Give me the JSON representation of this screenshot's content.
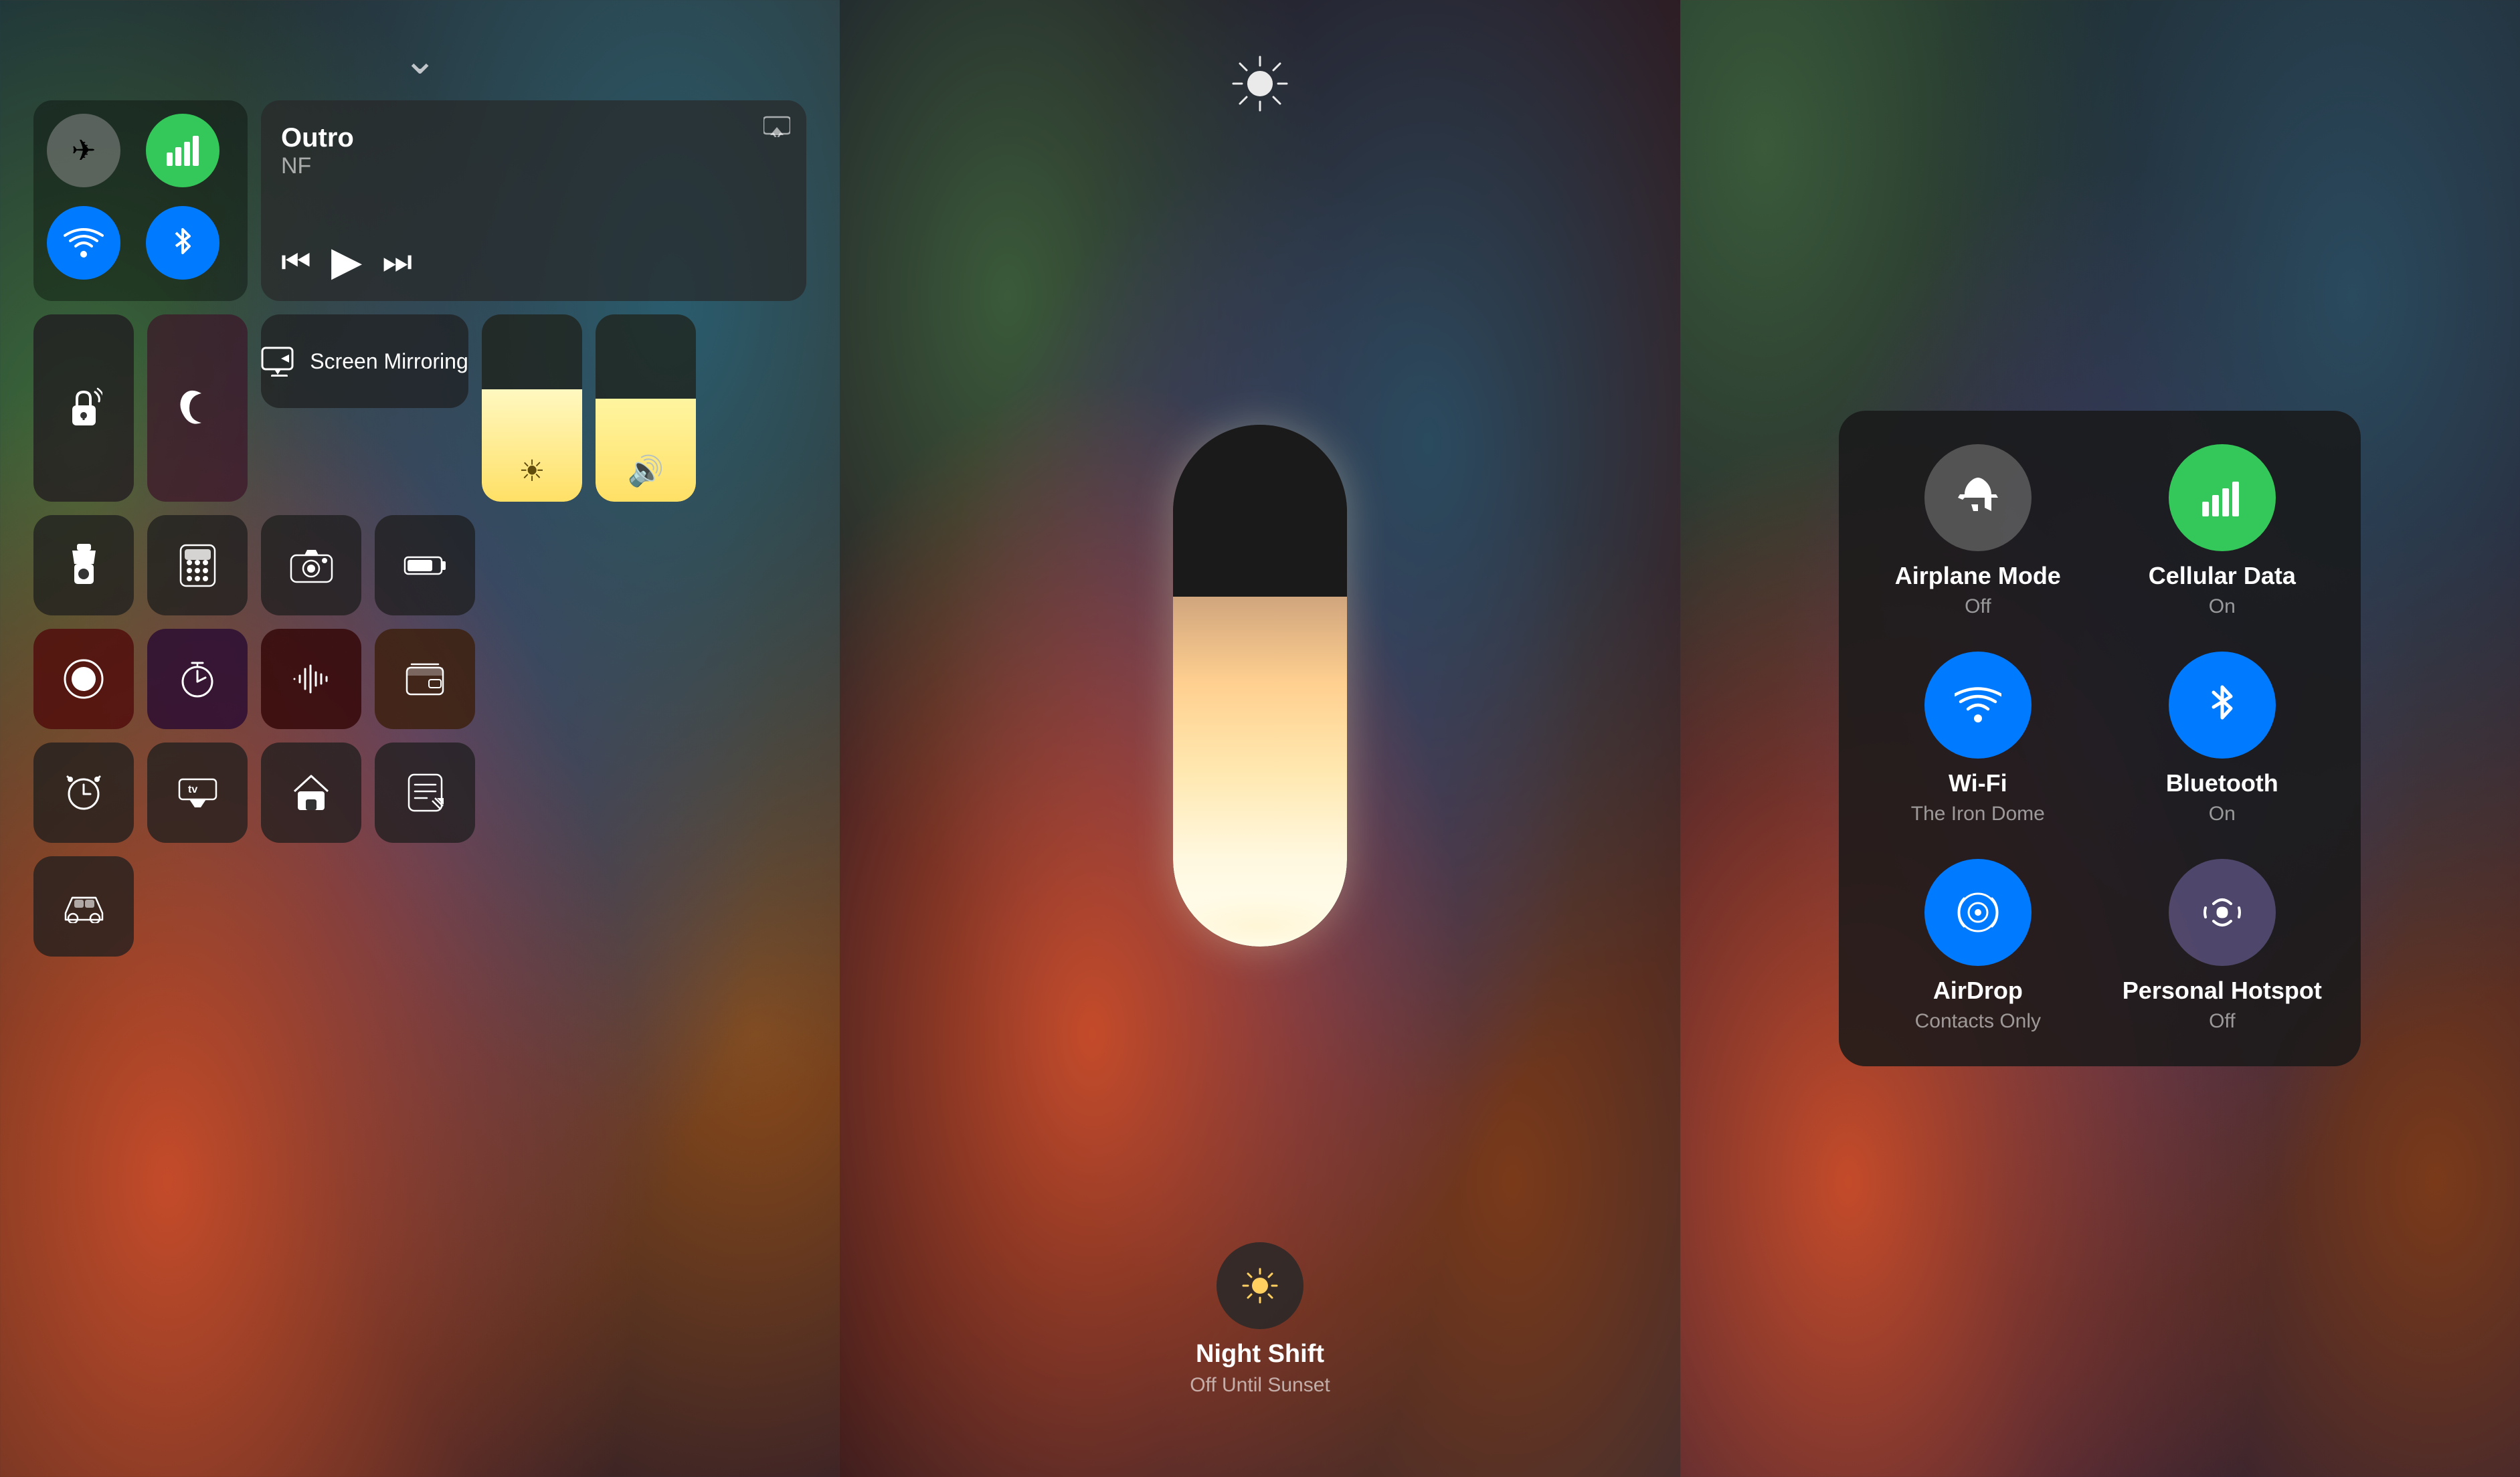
{
  "panel1": {
    "media": {
      "title": "Outro",
      "artist": "NF"
    },
    "connectivity": {
      "airplane": {
        "label": "Airplane Mode",
        "icon": "✈"
      },
      "cellular": {
        "label": "Cellular",
        "icon": "📶"
      },
      "wifi": {
        "label": "Wi-Fi",
        "icon": "📶"
      },
      "bluetooth": {
        "label": "Bluetooth",
        "icon": "🔵"
      }
    },
    "screen_mirroring": "Screen Mirroring",
    "icons": [
      {
        "id": "flashlight",
        "icon": "🔦",
        "color": "ic-dark"
      },
      {
        "id": "calculator",
        "icon": "🔢",
        "color": "ic-dark"
      },
      {
        "id": "camera",
        "icon": "📷",
        "color": "ic-dark"
      },
      {
        "id": "battery",
        "icon": "🔋",
        "color": "ic-dark"
      },
      {
        "id": "record",
        "icon": "⏺",
        "color": "ic-dark-red"
      },
      {
        "id": "timer",
        "icon": "⏱",
        "color": "ic-dark-purple"
      },
      {
        "id": "waveform",
        "icon": "〰",
        "color": "ic-dark-dark-red"
      },
      {
        "id": "wallet",
        "icon": "💳",
        "color": "ic-dark-brown"
      },
      {
        "id": "alarm",
        "icon": "⏰",
        "color": "ic-dark"
      },
      {
        "id": "appletv",
        "icon": "📺",
        "color": "ic-dark"
      },
      {
        "id": "home",
        "icon": "🏠",
        "color": "ic-dark"
      },
      {
        "id": "notes",
        "icon": "📝",
        "color": "ic-dark"
      }
    ]
  },
  "panel2": {
    "night_shift": {
      "label": "Night Shift",
      "sublabel": "Off Until Sunset"
    }
  },
  "panel3": {
    "connectivity": [
      {
        "id": "airplane-mode",
        "label": "Airplane Mode",
        "sublabel": "Off",
        "icon": "✈",
        "color": "gray"
      },
      {
        "id": "cellular-data",
        "label": "Cellular Data",
        "sublabel": "On",
        "icon": "📶",
        "color": "green"
      },
      {
        "id": "wifi",
        "label": "Wi-Fi",
        "sublabel": "The Iron Dome",
        "icon": "wifi",
        "color": "blue"
      },
      {
        "id": "bluetooth",
        "label": "Bluetooth",
        "sublabel": "On",
        "icon": "bt",
        "color": "blue"
      },
      {
        "id": "airdrop",
        "label": "AirDrop",
        "sublabel": "Contacts Only",
        "icon": "airdrop",
        "color": "blue"
      },
      {
        "id": "personal-hotspot",
        "label": "Personal Hotspot",
        "sublabel": "Off",
        "icon": "hotspot",
        "color": "purple"
      }
    ]
  }
}
